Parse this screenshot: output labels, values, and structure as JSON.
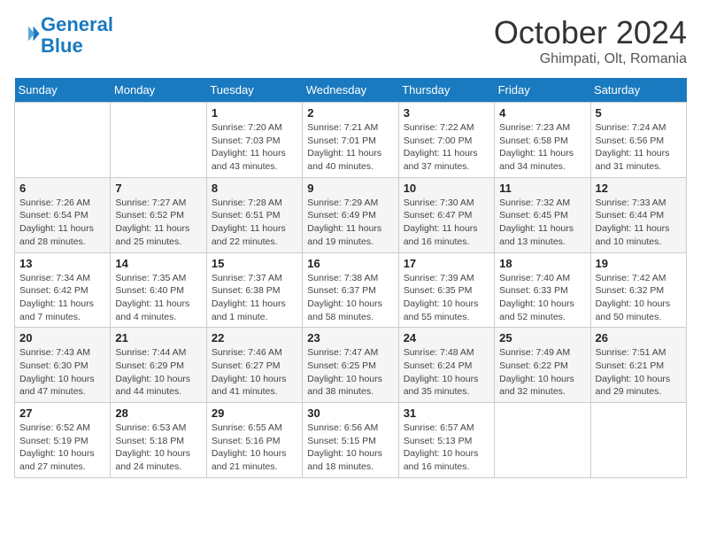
{
  "header": {
    "logo_line1": "General",
    "logo_line2": "Blue",
    "month": "October 2024",
    "location": "Ghimpati, Olt, Romania"
  },
  "weekdays": [
    "Sunday",
    "Monday",
    "Tuesday",
    "Wednesday",
    "Thursday",
    "Friday",
    "Saturday"
  ],
  "weeks": [
    [
      {
        "day": "",
        "info": ""
      },
      {
        "day": "",
        "info": ""
      },
      {
        "day": "1",
        "info": "Sunrise: 7:20 AM\nSunset: 7:03 PM\nDaylight: 11 hours and 43 minutes."
      },
      {
        "day": "2",
        "info": "Sunrise: 7:21 AM\nSunset: 7:01 PM\nDaylight: 11 hours and 40 minutes."
      },
      {
        "day": "3",
        "info": "Sunrise: 7:22 AM\nSunset: 7:00 PM\nDaylight: 11 hours and 37 minutes."
      },
      {
        "day": "4",
        "info": "Sunrise: 7:23 AM\nSunset: 6:58 PM\nDaylight: 11 hours and 34 minutes."
      },
      {
        "day": "5",
        "info": "Sunrise: 7:24 AM\nSunset: 6:56 PM\nDaylight: 11 hours and 31 minutes."
      }
    ],
    [
      {
        "day": "6",
        "info": "Sunrise: 7:26 AM\nSunset: 6:54 PM\nDaylight: 11 hours and 28 minutes."
      },
      {
        "day": "7",
        "info": "Sunrise: 7:27 AM\nSunset: 6:52 PM\nDaylight: 11 hours and 25 minutes."
      },
      {
        "day": "8",
        "info": "Sunrise: 7:28 AM\nSunset: 6:51 PM\nDaylight: 11 hours and 22 minutes."
      },
      {
        "day": "9",
        "info": "Sunrise: 7:29 AM\nSunset: 6:49 PM\nDaylight: 11 hours and 19 minutes."
      },
      {
        "day": "10",
        "info": "Sunrise: 7:30 AM\nSunset: 6:47 PM\nDaylight: 11 hours and 16 minutes."
      },
      {
        "day": "11",
        "info": "Sunrise: 7:32 AM\nSunset: 6:45 PM\nDaylight: 11 hours and 13 minutes."
      },
      {
        "day": "12",
        "info": "Sunrise: 7:33 AM\nSunset: 6:44 PM\nDaylight: 11 hours and 10 minutes."
      }
    ],
    [
      {
        "day": "13",
        "info": "Sunrise: 7:34 AM\nSunset: 6:42 PM\nDaylight: 11 hours and 7 minutes."
      },
      {
        "day": "14",
        "info": "Sunrise: 7:35 AM\nSunset: 6:40 PM\nDaylight: 11 hours and 4 minutes."
      },
      {
        "day": "15",
        "info": "Sunrise: 7:37 AM\nSunset: 6:38 PM\nDaylight: 11 hours and 1 minute."
      },
      {
        "day": "16",
        "info": "Sunrise: 7:38 AM\nSunset: 6:37 PM\nDaylight: 10 hours and 58 minutes."
      },
      {
        "day": "17",
        "info": "Sunrise: 7:39 AM\nSunset: 6:35 PM\nDaylight: 10 hours and 55 minutes."
      },
      {
        "day": "18",
        "info": "Sunrise: 7:40 AM\nSunset: 6:33 PM\nDaylight: 10 hours and 52 minutes."
      },
      {
        "day": "19",
        "info": "Sunrise: 7:42 AM\nSunset: 6:32 PM\nDaylight: 10 hours and 50 minutes."
      }
    ],
    [
      {
        "day": "20",
        "info": "Sunrise: 7:43 AM\nSunset: 6:30 PM\nDaylight: 10 hours and 47 minutes."
      },
      {
        "day": "21",
        "info": "Sunrise: 7:44 AM\nSunset: 6:29 PM\nDaylight: 10 hours and 44 minutes."
      },
      {
        "day": "22",
        "info": "Sunrise: 7:46 AM\nSunset: 6:27 PM\nDaylight: 10 hours and 41 minutes."
      },
      {
        "day": "23",
        "info": "Sunrise: 7:47 AM\nSunset: 6:25 PM\nDaylight: 10 hours and 38 minutes."
      },
      {
        "day": "24",
        "info": "Sunrise: 7:48 AM\nSunset: 6:24 PM\nDaylight: 10 hours and 35 minutes."
      },
      {
        "day": "25",
        "info": "Sunrise: 7:49 AM\nSunset: 6:22 PM\nDaylight: 10 hours and 32 minutes."
      },
      {
        "day": "26",
        "info": "Sunrise: 7:51 AM\nSunset: 6:21 PM\nDaylight: 10 hours and 29 minutes."
      }
    ],
    [
      {
        "day": "27",
        "info": "Sunrise: 6:52 AM\nSunset: 5:19 PM\nDaylight: 10 hours and 27 minutes."
      },
      {
        "day": "28",
        "info": "Sunrise: 6:53 AM\nSunset: 5:18 PM\nDaylight: 10 hours and 24 minutes."
      },
      {
        "day": "29",
        "info": "Sunrise: 6:55 AM\nSunset: 5:16 PM\nDaylight: 10 hours and 21 minutes."
      },
      {
        "day": "30",
        "info": "Sunrise: 6:56 AM\nSunset: 5:15 PM\nDaylight: 10 hours and 18 minutes."
      },
      {
        "day": "31",
        "info": "Sunrise: 6:57 AM\nSunset: 5:13 PM\nDaylight: 10 hours and 16 minutes."
      },
      {
        "day": "",
        "info": ""
      },
      {
        "day": "",
        "info": ""
      }
    ]
  ]
}
